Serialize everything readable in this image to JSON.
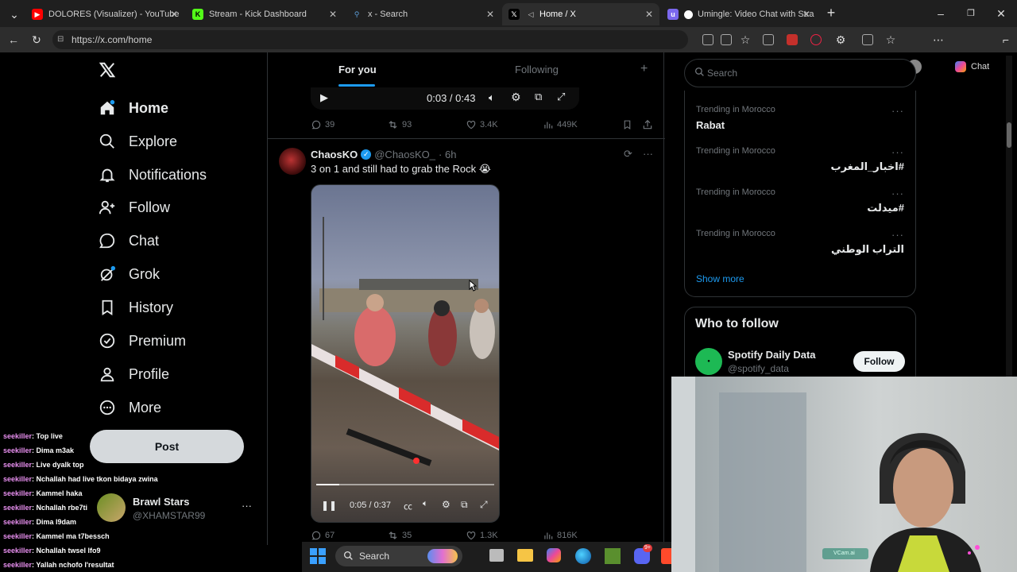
{
  "browser": {
    "tabs": [
      {
        "title": "DOLORES (Visualizer) - YouTube",
        "icon": "youtube-icon",
        "color": "#ff0000"
      },
      {
        "title": "Stream - Kick Dashboard",
        "icon": "kick-icon",
        "color": "#53fc18"
      },
      {
        "title": "x - Search",
        "icon": "search-icon",
        "color": "#5b9bd5"
      },
      {
        "title": "Home / X",
        "icon": "x-icon",
        "color": "#000000"
      },
      {
        "title": "Umingle: Video Chat with Stra",
        "icon": "umingle-icon",
        "color": "#7b68ee"
      }
    ],
    "url": "https://x.com/home",
    "chat_label": "Chat"
  },
  "sidebar": {
    "items": [
      {
        "label": "Home",
        "icon": "home-icon"
      },
      {
        "label": "Explore",
        "icon": "search-icon"
      },
      {
        "label": "Notifications",
        "icon": "bell-icon"
      },
      {
        "label": "Follow",
        "icon": "follow-icon"
      },
      {
        "label": "Chat",
        "icon": "chat-icon"
      },
      {
        "label": "Grok",
        "icon": "grok-icon"
      },
      {
        "label": "History",
        "icon": "bookmark-icon"
      },
      {
        "label": "Premium",
        "icon": "premium-icon"
      },
      {
        "label": "Profile",
        "icon": "person-icon"
      },
      {
        "label": "More",
        "icon": "more-icon"
      }
    ],
    "post_label": "Post",
    "account": {
      "name": "Brawl Stars",
      "handle": "@XHAMSTAR99"
    }
  },
  "feed": {
    "tabs": [
      "For you",
      "Following"
    ],
    "top_video": {
      "time": "0:03 / 0:43"
    },
    "top_metrics": {
      "replies": "39",
      "reposts": "93",
      "likes": "3.4K",
      "views": "449K"
    },
    "tweet": {
      "name": "ChaosKO",
      "handle": "@ChaosKO_",
      "time": "· 6h",
      "text": "3 on 1 and still had to grab the Rock 😭",
      "video_time": "0:05 / 0:37",
      "progress": 0.13
    },
    "bottom_metrics": {
      "replies": "67",
      "reposts": "35",
      "likes": "1.3K",
      "views": "816K"
    }
  },
  "right": {
    "search_placeholder": "Search",
    "trends": [
      {
        "meta": "Trending in Morocco",
        "name": "Rabat"
      },
      {
        "meta": "Trending in Morocco",
        "name": "#اخبار_المغرب"
      },
      {
        "meta": "Trending in Morocco",
        "name": "#ميدلت"
      },
      {
        "meta": "Trending in Morocco",
        "name": "التراب الوطني"
      }
    ],
    "show_more": "Show more",
    "who_to_follow": {
      "title": "Who to follow",
      "name": "Spotify Daily Data",
      "handle": "@spotify_data",
      "follow_label": "Follow"
    }
  },
  "chat_overlay": [
    {
      "user": "seekiller",
      "msg": ": Top live"
    },
    {
      "user": "seekiller",
      "msg": ": Dima m3ak"
    },
    {
      "user": "seekiller",
      "msg": ": Live dyalk top"
    },
    {
      "user": "seekiller",
      "msg": ": Nchallah had live tkon bidaya zwina"
    },
    {
      "user": "seekiller",
      "msg": ": Kammel haka"
    },
    {
      "user": "seekiller",
      "msg": ": Nchallah rbe7ti"
    },
    {
      "user": "seekiller",
      "msg": ": Dima l9dam"
    },
    {
      "user": "seekiller",
      "msg": ": Kammel ma t7bessch"
    },
    {
      "user": "seekiller",
      "msg": ": Nchallah twsel lfo9"
    },
    {
      "user": "seekiller",
      "msg": ": Yallah nchofo l'resultat"
    }
  ],
  "taskbar": {
    "search_label": "Search",
    "notification_count": "9+"
  },
  "webcam": {
    "label": "VCam.ai"
  }
}
